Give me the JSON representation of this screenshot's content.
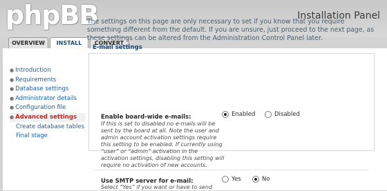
{
  "app": {
    "logo": "phpBB",
    "panel_title": "Installation Panel"
  },
  "tabs": [
    {
      "label": "OVERVIEW",
      "active": false
    },
    {
      "label": "INSTALL",
      "active": true
    },
    {
      "label": "CONVERT",
      "active": false
    }
  ],
  "sidebar": {
    "items": [
      {
        "label": "Introduction"
      },
      {
        "label": "Requirements"
      },
      {
        "label": "Database settings"
      },
      {
        "label": "Administrator details"
      },
      {
        "label": "Configuration file"
      },
      {
        "label": "Advanced settings",
        "active": true
      },
      {
        "label": "Create database tables"
      },
      {
        "label": "Final stage"
      }
    ]
  },
  "main": {
    "intro": "The settings on this page are only necessary to set if you know that you require something different from the default. If you are unsure, just proceed to the next page, as these settings can be altered from the Administration Control Panel later.",
    "section_title": "E-mail settings",
    "rows": [
      {
        "label": "Enable board-wide e-mails:",
        "desc": "If this is set to disabled no e-mails will be sent by the board at all. Note the user and admin account activation settings require this setting to be enabled. If currently using “user” or “admin” activation in the activation settings, disabling this setting will require no activation of new accounts.",
        "options": [
          {
            "label": "Enabled",
            "checked": true
          },
          {
            "label": "Disabled",
            "checked": false
          }
        ]
      },
      {
        "label": "Use SMTP server for e-mail:",
        "desc": "Select “Yes” if you want or have to send",
        "options": [
          {
            "label": "Yes",
            "checked": false
          },
          {
            "label": "No",
            "checked": true
          }
        ]
      }
    ]
  }
}
